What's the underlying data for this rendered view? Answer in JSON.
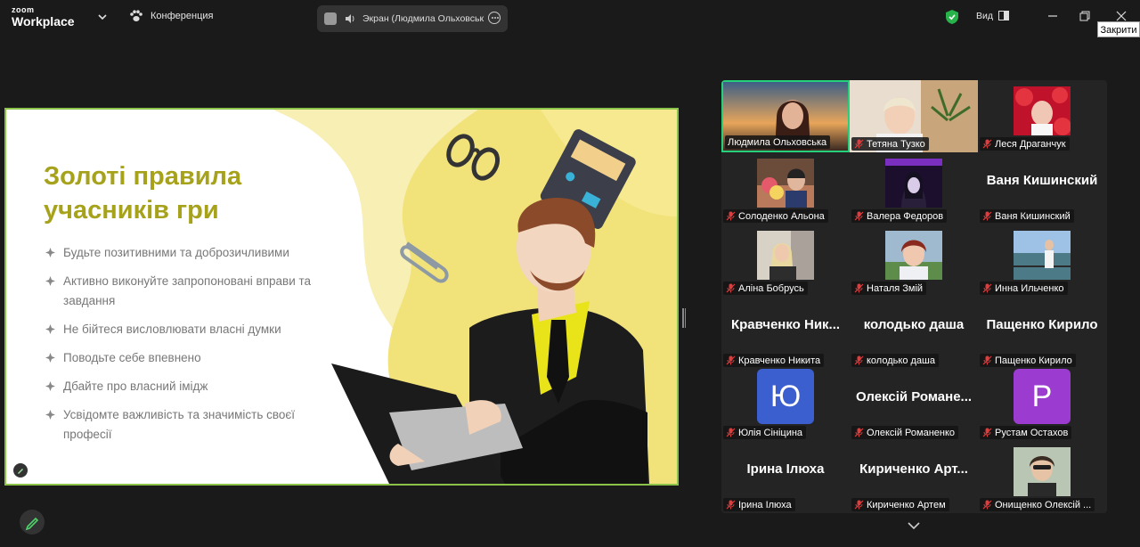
{
  "app": {
    "logo_top": "zoom",
    "logo_bottom": "Workplace",
    "meeting_label": "Конференция",
    "share_label": "Экран (Людмила Ольховська)",
    "view_label": "Вид",
    "tooltip": "Закрити",
    "accent": "#27d07a"
  },
  "slide": {
    "title": "Золоті правила учасників гри",
    "bullets": [
      "Будьте позитивними та доброзичливими",
      "Активно виконуйте запропоновані вправи та завдання",
      "Не бійтеся висловлювати власні думки",
      "Поводьте себе впевнено",
      "Дбайте про власний імідж",
      "Усвідомте важливість та значимість своєї професії"
    ]
  },
  "participants": [
    {
      "name": "Людмила Ольховська",
      "big": "",
      "muted": false,
      "video": true
    },
    {
      "name": "Тетяна Тузко",
      "big": "",
      "muted": true,
      "video": true
    },
    {
      "name": "Леся Драганчук",
      "big": "",
      "muted": true,
      "video": true
    },
    {
      "name": "Солоденко Альона",
      "big": "",
      "muted": true,
      "video": true
    },
    {
      "name": "Валера Федоров",
      "big": "",
      "muted": true,
      "video": true
    },
    {
      "name": "Ваня Кишинский",
      "big": "Ваня Кишинский",
      "muted": true,
      "video": false
    },
    {
      "name": "Аліна Бобрусь",
      "big": "",
      "muted": true,
      "video": true
    },
    {
      "name": "Наталя Змій",
      "big": "",
      "muted": true,
      "video": true
    },
    {
      "name": "Инна Ильченко",
      "big": "",
      "muted": true,
      "video": true
    },
    {
      "name": "Кравченко Никита",
      "big": "Кравченко Ник...",
      "muted": true,
      "video": false
    },
    {
      "name": "колодько даша",
      "big": "колодько даша",
      "muted": true,
      "video": false
    },
    {
      "name": "Пащенко Кирило",
      "big": "Пащенко Кирило",
      "muted": true,
      "video": false
    },
    {
      "name": "Юлія Сініцина",
      "big": "",
      "muted": true,
      "video": false,
      "letter": "Ю"
    },
    {
      "name": "Олексій Романенко",
      "big": "Олексій Романе...",
      "muted": true,
      "video": false
    },
    {
      "name": "Рустам Остахов",
      "big": "",
      "muted": true,
      "video": false,
      "letter": "P"
    },
    {
      "name": "Ірина Іл юха",
      "big": "Ірина Ілюха",
      "muted": true,
      "video": false
    },
    {
      "name": "Кириченко Артем",
      "big": "Кириченко Арт...",
      "muted": true,
      "video": false
    },
    {
      "name": "Онищенко Олексій ...",
      "big": "",
      "muted": true,
      "video": true
    }
  ]
}
